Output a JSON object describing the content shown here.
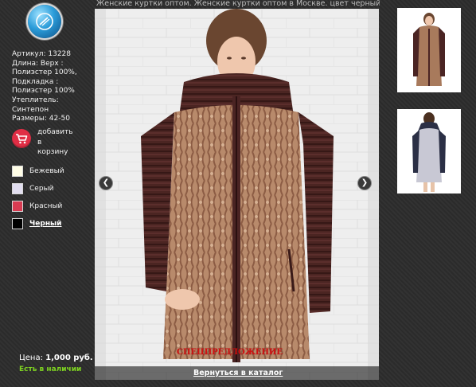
{
  "header": {
    "title": "Женские куртки оптом. Женские куртки оптом в Москве. цвет черный"
  },
  "specs": {
    "lines": [
      "Артикул: 13228",
      "Длина: Верх :",
      "Полиэстер 100%,",
      "Подкладка :",
      "Полиэстер 100%",
      "Утеплитель:",
      "Синтепон",
      "Размеры: 42-50"
    ]
  },
  "cart": {
    "icon": "cart-icon",
    "label_line1": "добавить",
    "label_line2": "в",
    "label_line3": "корзину"
  },
  "colors": [
    {
      "label": "Бежевый",
      "swatch": "#fffde6"
    },
    {
      "label": "Серый",
      "swatch": "#e2def0"
    },
    {
      "label": "Красный",
      "swatch": "#d83b52"
    },
    {
      "label": "Черный",
      "swatch": "#000000",
      "selected": true
    }
  ],
  "price": {
    "label": "Цена:",
    "value": "1,000 руб."
  },
  "stock": "Есть в наличии",
  "promo": "СПЕЦПРЕДЛОЖЕНИЕ",
  "catalog_link": "Вернуться в каталог",
  "gallery": {
    "prev_icon": "chevron-left-icon",
    "next_icon": "chevron-right-icon"
  },
  "palette": {
    "jacket_brown": "#4a2423",
    "jacket_beige": "#b98a6a",
    "stock_green": "#7ed321",
    "promo_red": "#d01010"
  }
}
